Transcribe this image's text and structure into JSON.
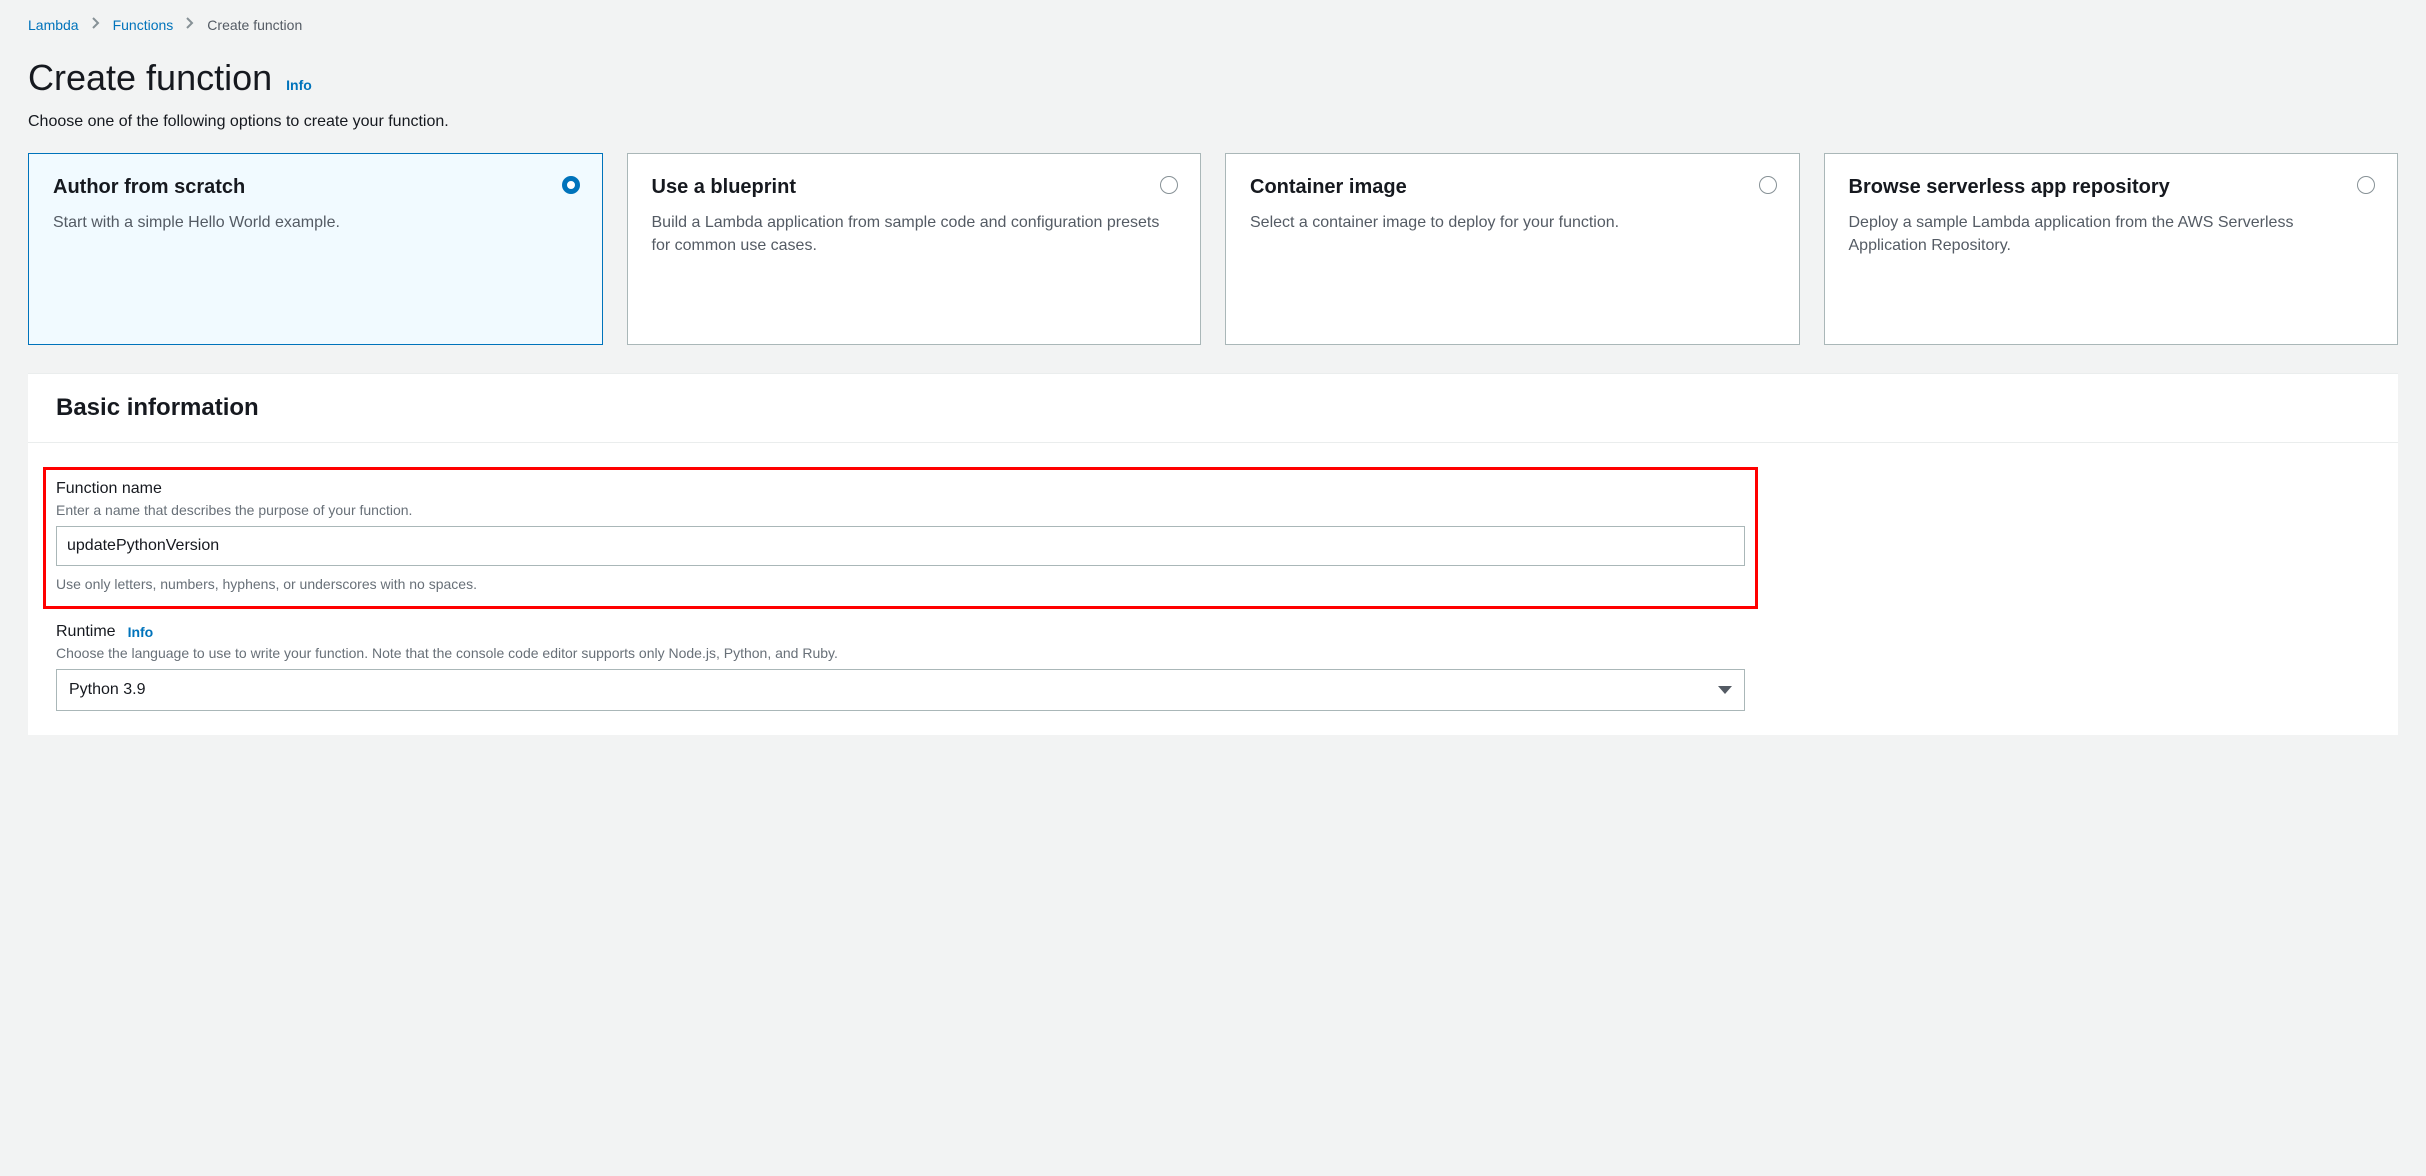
{
  "breadcrumb": {
    "items": [
      {
        "label": "Lambda",
        "link": true
      },
      {
        "label": "Functions",
        "link": true
      },
      {
        "label": "Create function",
        "link": false
      }
    ]
  },
  "header": {
    "title": "Create function",
    "info": "Info",
    "subtitle": "Choose one of the following options to create your function."
  },
  "options": [
    {
      "title": "Author from scratch",
      "desc": "Start with a simple Hello World example.",
      "selected": true
    },
    {
      "title": "Use a blueprint",
      "desc": "Build a Lambda application from sample code and configuration presets for common use cases.",
      "selected": false
    },
    {
      "title": "Container image",
      "desc": "Select a container image to deploy for your function.",
      "selected": false
    },
    {
      "title": "Browse serverless app repository",
      "desc": "Deploy a sample Lambda application from the AWS Serverless Application Repository.",
      "selected": false
    }
  ],
  "basic": {
    "heading": "Basic information",
    "functionName": {
      "label": "Function name",
      "desc": "Enter a name that describes the purpose of your function.",
      "value": "updatePythonVersion",
      "constraint": "Use only letters, numbers, hyphens, or underscores with no spaces."
    },
    "runtime": {
      "label": "Runtime",
      "info": "Info",
      "desc": "Choose the language to use to write your function. Note that the console code editor supports only Node.js, Python, and Ruby.",
      "value": "Python 3.9"
    }
  },
  "annotation": {
    "functionNameHighlighted": true
  }
}
